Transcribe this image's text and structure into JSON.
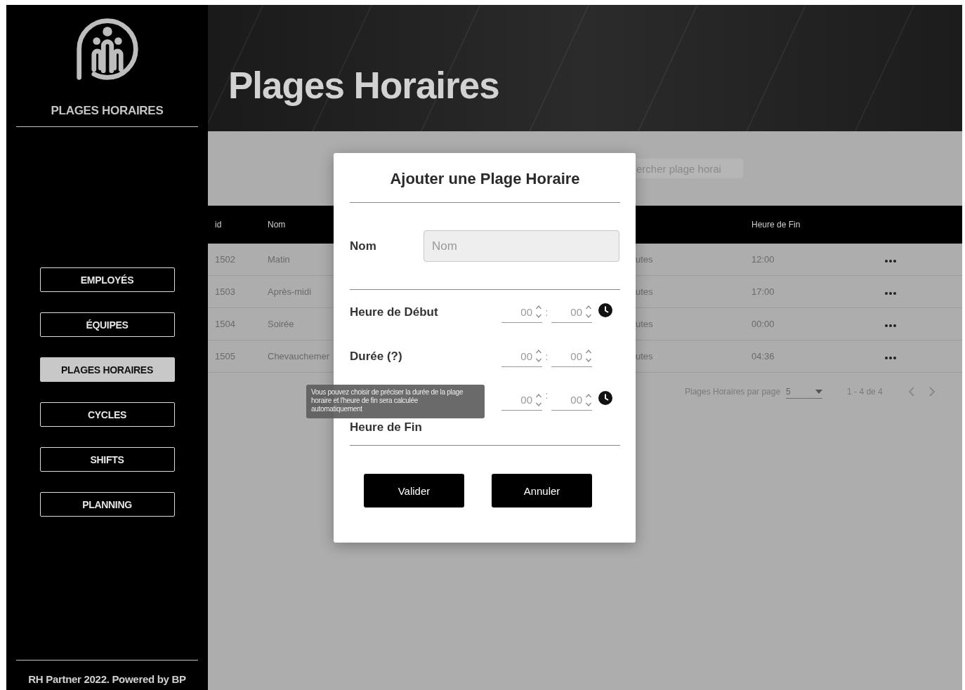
{
  "sidebar": {
    "title": "PLAGES HORAIRES",
    "nav": [
      {
        "label": "EMPLOYÉS",
        "selected": false
      },
      {
        "label": "ÉQUIPES",
        "selected": false
      },
      {
        "label": "PLAGES HORAIRES",
        "selected": true
      },
      {
        "label": "CYCLES",
        "selected": false
      },
      {
        "label": "SHIFTS",
        "selected": false
      },
      {
        "label": "PLANNING",
        "selected": false
      }
    ],
    "footer": "RH Partner 2022. Powered by BP"
  },
  "header": {
    "title": "Plages Horaires"
  },
  "toolbar": {
    "search_placeholder": "ercher plage horai"
  },
  "table": {
    "columns": [
      "id",
      "Nom",
      "Heure de Fin"
    ],
    "rows": [
      {
        "id": "1502",
        "name": "Matin",
        "column_3": "utes",
        "end": "12:00"
      },
      {
        "id": "1503",
        "name": "Après-midi",
        "column_3": "utes",
        "end": "17:00"
      },
      {
        "id": "1504",
        "name": "Soirée",
        "column_3": "utes",
        "end": "00:00"
      },
      {
        "id": "1505",
        "name": "Chevauchemer",
        "column_3": "utes",
        "end": "04:36"
      }
    ]
  },
  "pagination": {
    "label": "Plages Horaires par page",
    "per_page": "5",
    "range": "1 - 4 de 4"
  },
  "dialog": {
    "title": "Ajouter une Plage Horaire",
    "name_label": "Nom",
    "name_placeholder": "Nom",
    "time_rows": [
      {
        "label": "Heure de Début",
        "hours": "00",
        "separator": ":",
        "minutes": "00",
        "clock": true
      },
      {
        "label": "Durée (?)",
        "hours": "00",
        "separator": ":",
        "minutes": "00",
        "clock": false
      },
      {
        "label": "Heure de Fin",
        "hours": "00",
        "separator": ":",
        "minutes": "00",
        "clock": true
      }
    ],
    "tooltip": "Vous pouvez choisir de préciser la durée de la plage horaire et l'heure de fin sera calculée automatiquement",
    "buttons": [
      "Valider",
      "Annuler"
    ]
  }
}
